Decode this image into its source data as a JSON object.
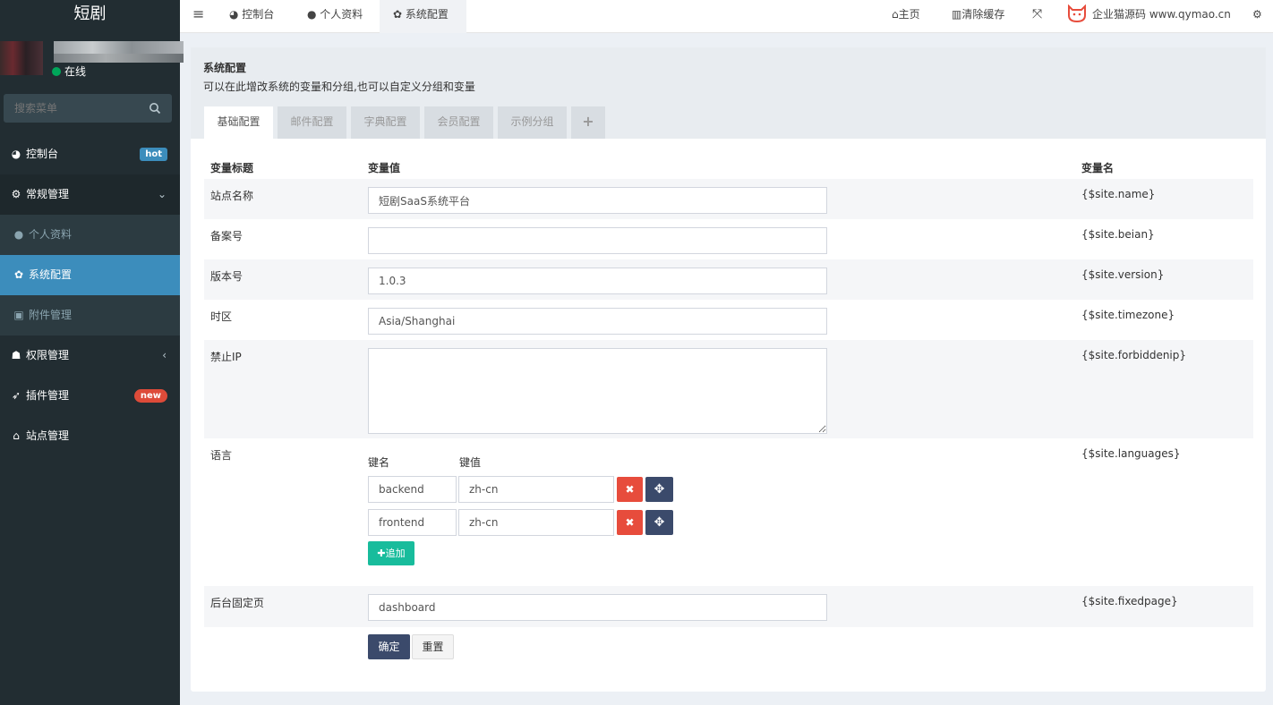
{
  "sidebar": {
    "logo": "短剧",
    "status": "在线",
    "search_placeholder": "搜索菜单",
    "items": [
      {
        "label": "控制台",
        "badge": "hot"
      },
      {
        "label": "常规管理"
      },
      {
        "label": "个人资料"
      },
      {
        "label": "系统配置"
      },
      {
        "label": "附件管理"
      },
      {
        "label": "权限管理"
      },
      {
        "label": "插件管理",
        "badge": "new"
      },
      {
        "label": "站点管理"
      }
    ]
  },
  "topbar": {
    "tabs": [
      {
        "label": "控制台"
      },
      {
        "label": "个人资料"
      },
      {
        "label": "系统配置"
      }
    ],
    "home": "主页",
    "clear_cache": "清除缓存",
    "brand": "企业猫源码 www.qymao.cn"
  },
  "panel": {
    "title": "系统配置",
    "subtitle": "可以在此增改系统的变量和分组,也可以自定义分组和变量",
    "tabs": [
      "基础配置",
      "邮件配置",
      "字典配置",
      "会员配置",
      "示例分组",
      "+"
    ]
  },
  "table": {
    "headers": {
      "title": "变量标题",
      "value": "变量值",
      "name": "变量名"
    },
    "rows": [
      {
        "label": "站点名称",
        "value": "短剧SaaS系统平台",
        "var": "{$site.name}"
      },
      {
        "label": "备案号",
        "value": "",
        "var": "{$site.beian}"
      },
      {
        "label": "版本号",
        "value": "1.0.3",
        "var": "{$site.version}"
      },
      {
        "label": "时区",
        "value": "Asia/Shanghai",
        "var": "{$site.timezone}"
      },
      {
        "label": "禁止IP",
        "value": "",
        "var": "{$site.forbiddenip}"
      },
      {
        "label": "语言",
        "var": "{$site.languages}"
      },
      {
        "label": "后台固定页",
        "value": "dashboard",
        "var": "{$site.fixedpage}"
      }
    ],
    "languages": {
      "key_header": "键名",
      "value_header": "键值",
      "pairs": [
        {
          "key": "backend",
          "value": "zh-cn"
        },
        {
          "key": "frontend",
          "value": "zh-cn"
        }
      ],
      "add_label": "追加"
    },
    "submit_label": "确定",
    "reset_label": "重置"
  },
  "colors": {
    "sidebar_bg": "#222d32",
    "active_blue": "#3c8dbc",
    "danger": "#dd4b39",
    "success": "#18bc9c",
    "primary_dark": "#3b4a6b",
    "online": "#00a65a"
  }
}
